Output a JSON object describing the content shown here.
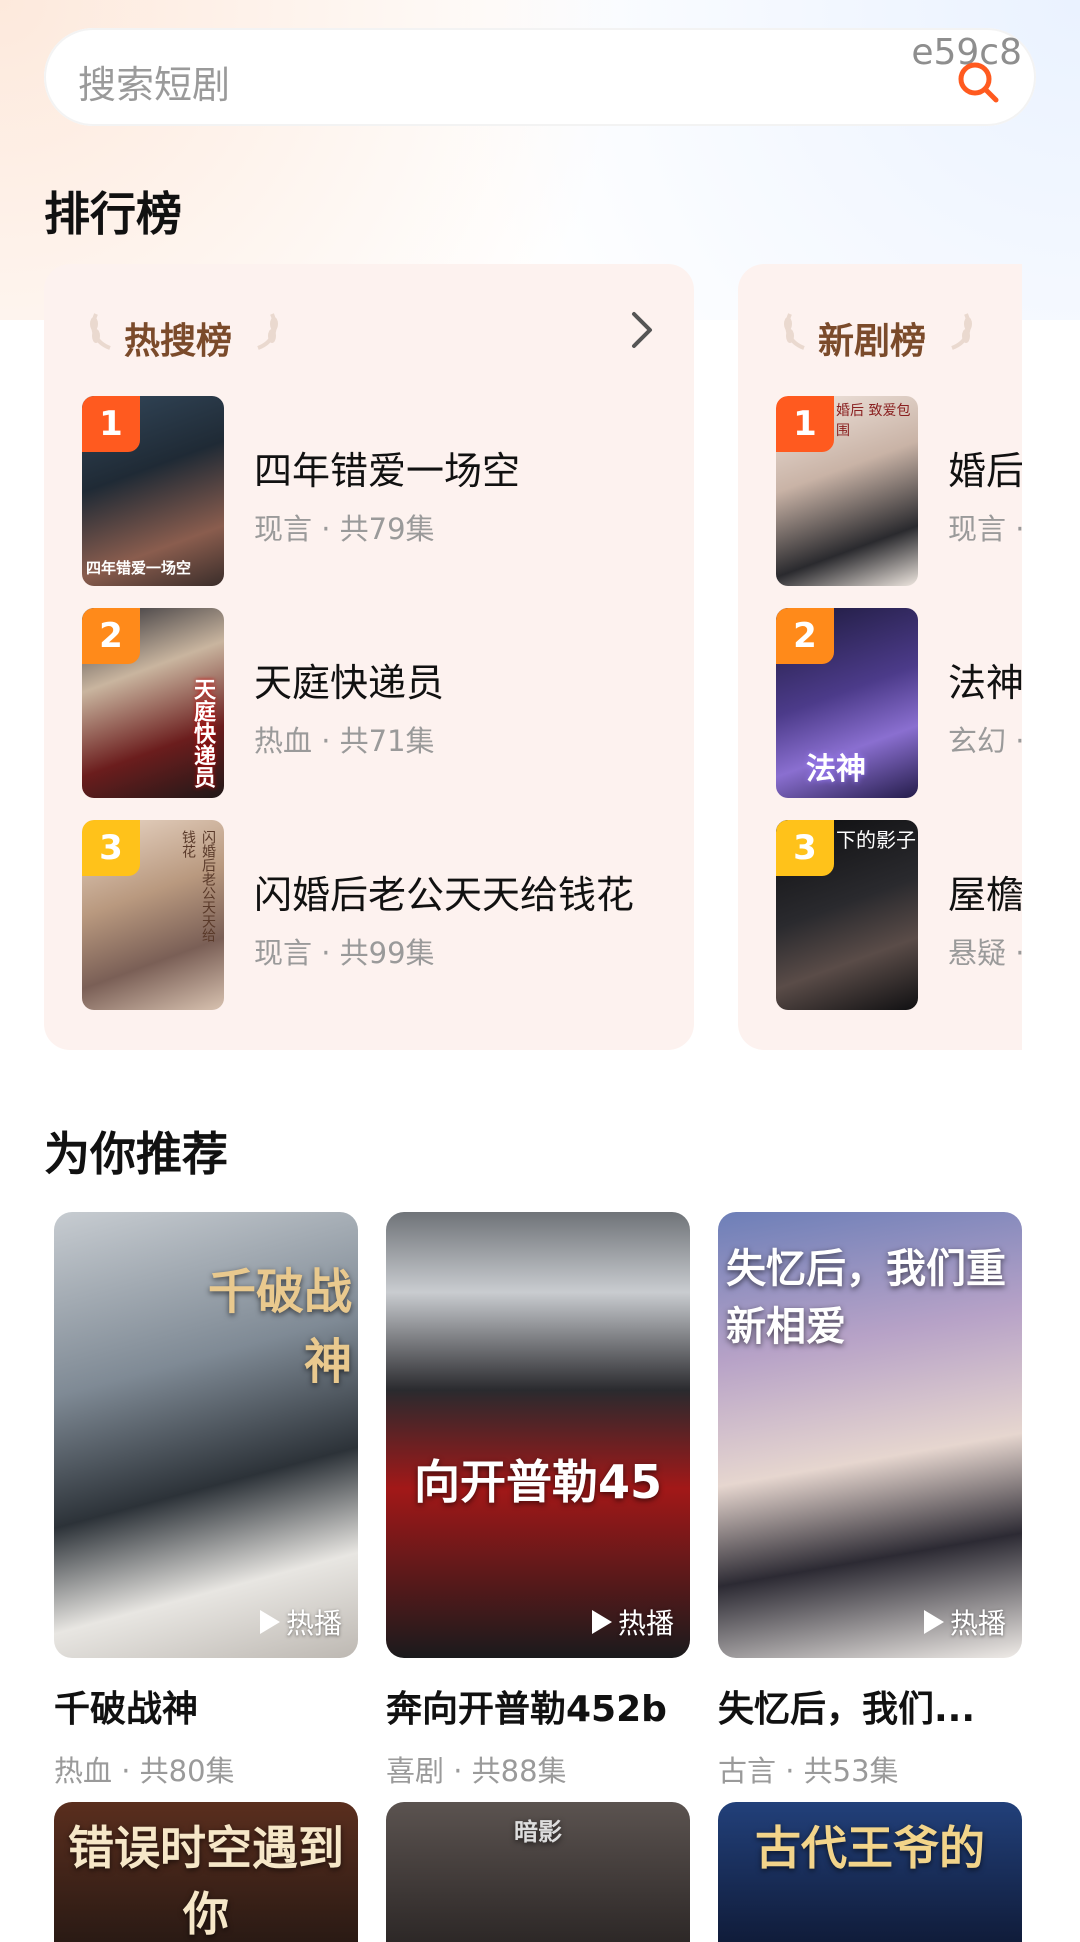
{
  "search": {
    "placeholder": "搜索短剧",
    "code": "e59c8"
  },
  "sections": {
    "ranking": "排行榜",
    "recommend": "为你推荐"
  },
  "ranking_cards": [
    {
      "title": "热搜榜",
      "items": [
        {
          "rank": "1",
          "title": "四年错爱一场空",
          "meta": "现言 · 共79集",
          "poster_caption": "四年错爱一场空"
        },
        {
          "rank": "2",
          "title": "天庭快递员",
          "meta": "热血 · 共71集",
          "poster_caption": "天庭快递员"
        },
        {
          "rank": "3",
          "title": "闪婚后老公天天给钱花",
          "meta": "现言 · 共99集",
          "poster_caption": "闪婚后老公天天给钱花"
        }
      ]
    },
    {
      "title": "新剧榜",
      "items": [
        {
          "rank": "1",
          "title": "婚后",
          "meta": "现言 ·",
          "poster_caption": "婚后 致爱包围"
        },
        {
          "rank": "2",
          "title": "法神",
          "meta": "玄幻 ·",
          "poster_caption": "法神"
        },
        {
          "rank": "3",
          "title": "屋檐",
          "meta": "悬疑 ·",
          "poster_caption": "下的影子"
        }
      ]
    }
  ],
  "recommend": [
    {
      "title": "千破战神",
      "meta": "热血 · 共80集",
      "hot_label": "热播",
      "poster_text": "千破战神"
    },
    {
      "title": "奔向开普勒452b",
      "meta": "喜剧 · 共88集",
      "hot_label": "热播",
      "poster_text": "向开普勒45"
    },
    {
      "title": "失忆后，我们...",
      "meta": "古言 · 共53集",
      "hot_label": "热播",
      "poster_text": "失忆后，我们重新相爱"
    }
  ],
  "bottom_row": [
    {
      "poster_text": "错误时空遇到你"
    },
    {
      "poster_text": "暗影"
    },
    {
      "poster_text": "古代王爷的"
    }
  ],
  "colors": {
    "accent": "#ff5a1f",
    "card_bg": "#fdf2ef",
    "meta": "#9a9a9a"
  }
}
